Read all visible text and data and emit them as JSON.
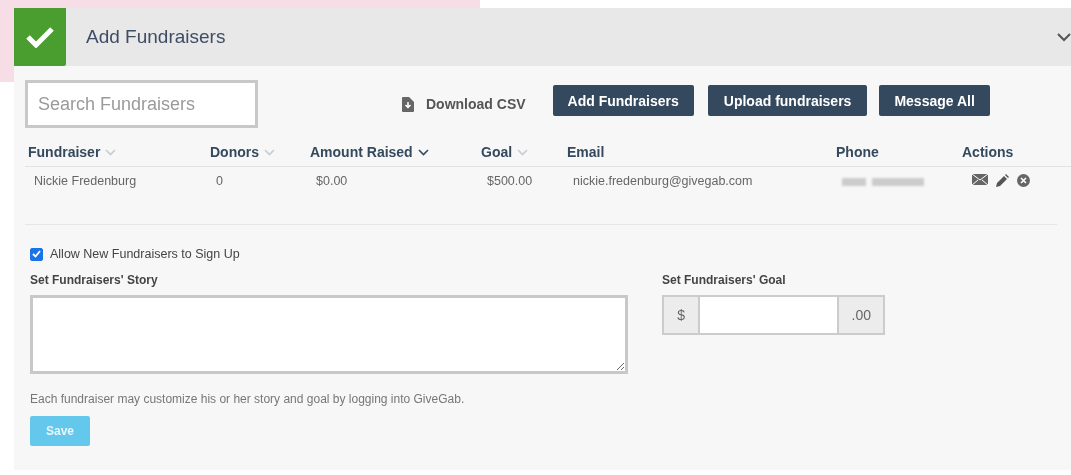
{
  "header": {
    "title": "Add Fundraisers",
    "completed": true,
    "expanded": true
  },
  "search": {
    "placeholder": "Search Fundraisers"
  },
  "download": {
    "label": "Download CSV"
  },
  "buttons": [
    "Add Fundraisers",
    "Upload fundraisers",
    "Message All"
  ],
  "table": {
    "columns": [
      {
        "label": "Fundraiser",
        "sorted": false
      },
      {
        "label": "Donors",
        "sorted": false
      },
      {
        "label": "Amount Raised",
        "sorted": true
      },
      {
        "label": "Goal",
        "sorted": false
      },
      {
        "label": "Email"
      },
      {
        "label": "Phone"
      },
      {
        "label": "Actions"
      }
    ],
    "rows": [
      {
        "cells": [
          "Nickie Fredenburg",
          "0",
          "$0.00",
          "$500.00",
          "nickie.fredenburg@givegab.com"
        ]
      }
    ]
  },
  "allow_signup": {
    "label": "Allow New Fundraisers to Sign Up",
    "checked": true
  },
  "story": {
    "label": "Set Fundraisers' Story"
  },
  "goal": {
    "label": "Set Fundraisers' Goal",
    "prefix": "$",
    "suffix": ".00"
  },
  "help": "Each fundraiser may customize his or her story and goal by logging into GiveGab.",
  "save": {
    "label": "Save",
    "disabled": true
  }
}
